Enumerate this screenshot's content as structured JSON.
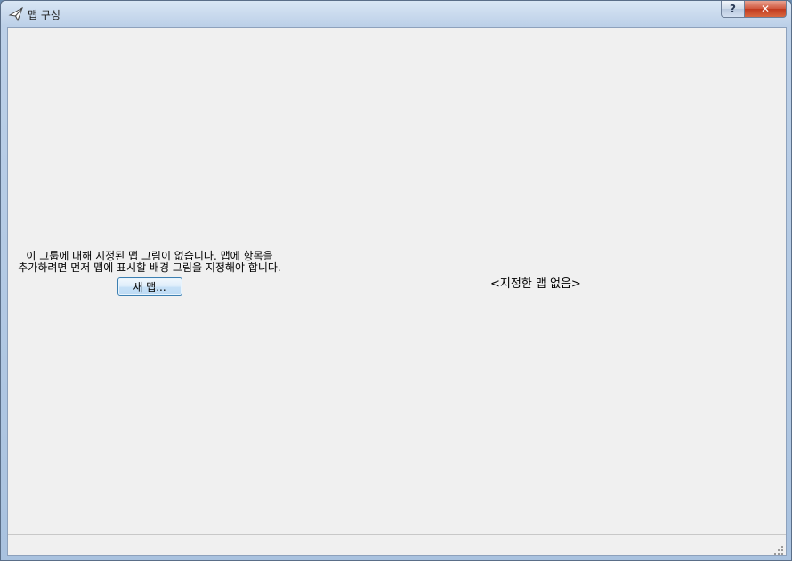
{
  "window": {
    "title": "맵 구성",
    "icon": "paper-plane-icon",
    "help_label": "?",
    "close_label": "✕"
  },
  "left_panel": {
    "message": "이 그룹에 대해 지정된 맵 그림이 없습니다.  맵에 항목을 추가하려면 먼저 맵에 표시할 배경 그림을 지정해야 합니다.",
    "new_map_button": "새 맵..."
  },
  "right_panel": {
    "empty_label": "<지정한 맵 없음>"
  },
  "colors": {
    "client_bg": "#f0f0f0",
    "close_button": "#c13a1f",
    "button_border": "#3c7fb1"
  }
}
